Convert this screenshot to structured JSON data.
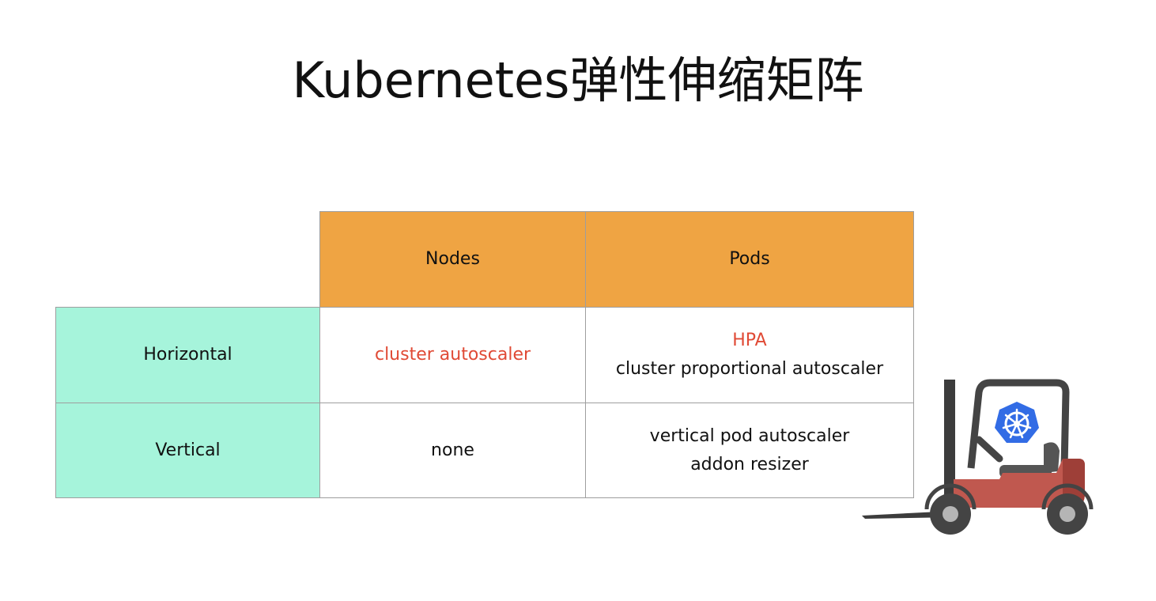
{
  "slide": {
    "title": "Kubernetes弹性伸缩矩阵"
  },
  "matrix": {
    "column_headers": [
      "Nodes",
      "Pods"
    ],
    "rows": [
      {
        "label": "Horizontal",
        "nodes": [
          "cluster autoscaler"
        ],
        "pods": [
          "HPA",
          "cluster proportional autoscaler"
        ]
      },
      {
        "label": "Vertical",
        "nodes": [
          "none"
        ],
        "pods": [
          "vertical pod autoscaler",
          "addon resizer"
        ]
      }
    ]
  },
  "illustration": {
    "icon": "kubernetes-forklift-icon"
  },
  "colors": {
    "header_fill": "#efa443",
    "row_header_fill": "#a6f4db",
    "highlight_text": "#e04a35",
    "grid_line": "#9e9e9e",
    "forklift_body": "#c0584f",
    "kubernetes_blue": "#326ce5"
  }
}
